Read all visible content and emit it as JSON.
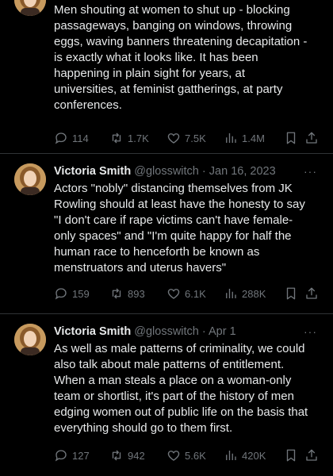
{
  "colors": {
    "background": "#000000",
    "text": "#e7e9ea",
    "muted": "#71767b",
    "divider": "#2f3336"
  },
  "icons": {
    "reply": "speech-bubble-icon",
    "retweet": "retweet-arrows-icon",
    "like": "heart-icon",
    "views": "bar-chart-icon",
    "bookmark": "bookmark-icon",
    "share": "share-upload-icon",
    "more": "ellipsis-icon"
  },
  "tweets": [
    {
      "text": "Men shouting at women to shut up - blocking\npassageways, banging on windows, throwing\neggs, waving banners threatening decapitation -\nis exactly what it looks like. It has been\nhappening in plain sight for years, at\nuniversities, at feminist gattherings, at party\nconferences.",
      "replies": "114",
      "retweets": "1.7K",
      "likes": "7.5K",
      "views": "1.4M"
    },
    {
      "name": "Victoria Smith",
      "handle": "@glosswitch",
      "separator": "·",
      "date": "Jan 16, 2023",
      "more": "···",
      "text": "Actors \"nobly\" distancing themselves from JK\nRowling should at least have the honesty to say\n\"I don't care if rape victims can't have female-\nonly spaces\" and \"I'm quite happy for half the\nhuman race to henceforth be known as\nmenstruators and uterus havers\"",
      "replies": "159",
      "retweets": "893",
      "likes": "6.1K",
      "views": "288K"
    },
    {
      "name": "Victoria Smith",
      "handle": "@glosswitch",
      "separator": "·",
      "date": "Apr 1",
      "more": "···",
      "text": "As well as male patterns of criminality, we could\nalso talk about male patterns of entitlement.\nWhen a man steals a place on a woman-only\nteam or shortlist, it's part of the history of men\nedging women out of public life on the basis that\neverything should go to them first.",
      "replies": "127",
      "retweets": "942",
      "likes": "5.6K",
      "views": "420K"
    }
  ]
}
